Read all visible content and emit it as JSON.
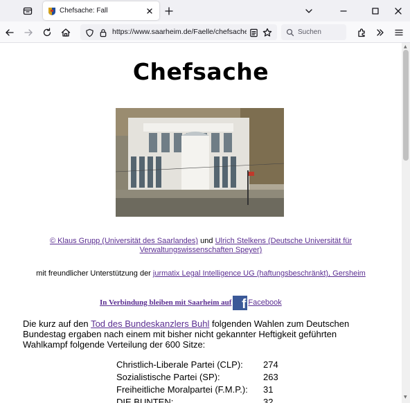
{
  "browser": {
    "tab_title": "Chefsache: Fall",
    "url": "https://www.saarheim.de/Faelle/chefsache",
    "search_placeholder": "Suchen"
  },
  "page": {
    "title": "Chefsache",
    "credits": {
      "author1": "© Klaus Grupp (Universität des Saarlandes)",
      "and": "und",
      "author2": "Ulrich Stelkens (Deutsche Universität für Verwaltungswissenschaften Speyer)"
    },
    "support": {
      "prefix": "mit freundlicher Unterstützung der",
      "link": "jurmatix Legal Intelligence UG (haftungsbeschränkt), Gersheim"
    },
    "connect": {
      "text": "In Verbindung bleiben mit Saarheim auf",
      "facebook": "Facebook"
    },
    "intro": {
      "before": "Die kurz auf den",
      "link": "Tod des Bundeskanzlers Buhl",
      "after": "folgenden Wahlen zum Deutschen Bundestag ergaben nach einem mit bisher nicht gekannter Heftigkeit geführten Wahlkampf folgende Verteilung der 600 Sitze:"
    },
    "seats": [
      {
        "party": "Christlich-Liberale Partei (CLP):",
        "count": "274"
      },
      {
        "party": "Sozialistische Partei (SP):",
        "count": "263"
      },
      {
        "party": "Freiheitliche Moralpartei (F.M.P.):",
        "count": "31"
      },
      {
        "party": "DIE BUNTEN:",
        "count": "32"
      }
    ]
  },
  "colors": {
    "link": "#5a2d91",
    "facebook": "#3b5998"
  }
}
